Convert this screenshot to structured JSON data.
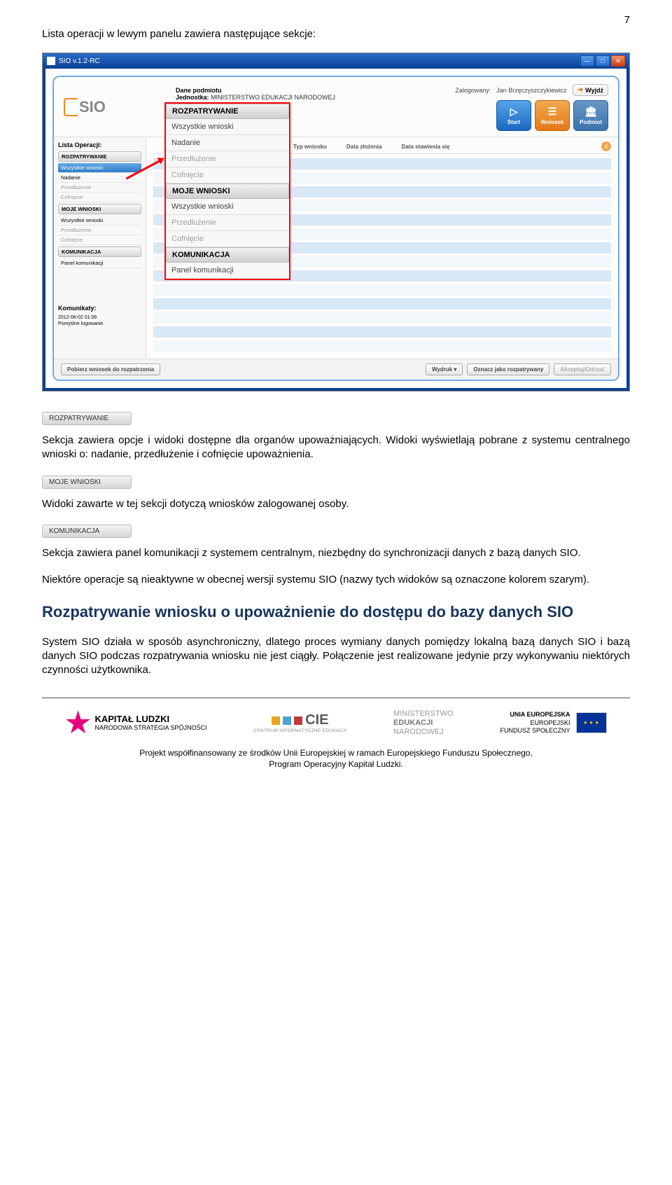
{
  "page_number": "7",
  "intro": "Lista operacji w lewym panelu zawiera następujące sekcje:",
  "screenshot": {
    "titlebar": "SIO v.1.2-RC",
    "logo_text": "SIO",
    "dane_podmiotu_label": "Dane podmiotu",
    "jednostka_label": "Jednostka:",
    "jednostka_value": "MINISTERSTWO EDUKACJI NARODOWEJ",
    "logged_label": "Zalogowany:",
    "logged_value": "Jan Brzęczyszczykiewicz",
    "wyjdz": "Wyjdź",
    "actions": {
      "start": "Start",
      "wniosek": "Wniosek",
      "podmiot": "Podmiot"
    },
    "left_title": "Lista Operacji:",
    "left": {
      "h1": "ROZPATRYWANIE",
      "i1": "Wszystkie wnioski",
      "i2": "Nadanie",
      "i3": "Przedłużenie",
      "i4": "Cofnięcie",
      "h2": "MOJE WNIOSKI",
      "i5": "Wszystkie wnioski",
      "i6": "Przedłużenie",
      "i7": "Cofnięcie",
      "h3": "KOMUNIKACJA",
      "i8": "Panel komunikacji"
    },
    "popup": {
      "h1": "ROZPATRYWANIE",
      "i1": "Wszystkie wnioski",
      "i2": "Nadanie",
      "i3": "Przedłużenie",
      "i4": "Cofnięcie",
      "h2": "MOJE WNIOSKI",
      "i5": "Wszystkie wnioski",
      "i6": "Przedłużenie",
      "i7": "Cofnięcie",
      "h3": "KOMUNIKACJA",
      "i8": "Panel komunikacji"
    },
    "komunikaty_label": "Komunikaty:",
    "komunikat_date": "2012-06-02 01:06",
    "komunikat_text": "Pomyślne logowanie",
    "th": {
      "typ": "Typ wniosku",
      "data_z": "Data złożenia",
      "data_s": "Data stawienia się"
    },
    "footer": {
      "pobierz": "Pobierz wniosek do rozpatrzenia",
      "wydruk": "Wydruk",
      "oznacz": "Oznacz jako rozpatrywany",
      "akceptuj": "Akceptuj/Odrzuć"
    }
  },
  "tab1": "ROZPATRYWANIE",
  "para1": "Sekcja zawiera opcje i widoki dostępne dla organów upoważniających. Widoki wyświetlają pobrane z systemu centralnego wnioski o: nadanie, przedłużenie i cofnięcie upoważnienia.",
  "tab2": "MOJE WNIOSKI",
  "para2": "Widoki zawarte w tej sekcji dotyczą wniosków zalogowanej osoby.",
  "tab3": "KOMUNIKACJA",
  "para3": "Sekcja zawiera panel komunikacji z systemem centralnym, niezbędny do synchronizacji danych z bazą danych SIO.",
  "para4": "Niektóre operacje są nieaktywne w obecnej wersji systemu SIO (nazwy tych widoków są oznaczone kolorem szarym).",
  "heading": "Rozpatrywanie wniosku o upoważnienie do dostępu do bazy danych SIO",
  "para5": "System SIO działa w sposób asynchroniczny, dlatego proces wymiany danych pomiędzy lokalną bazą danych SIO i bazą danych SIO podczas rozpatrywania wniosku nie jest ciągły. Połączenie jest realizowane jedynie przy wykonywaniu niektórych czynności użytkownika.",
  "footer": {
    "kl_big": "KAPITAŁ LUDZKI",
    "kl_small": "NARODOWA STRATEGIA SPÓJNOŚCI",
    "cie": "CIE",
    "cie_sub": "CENTRUM INFORMATYCZNE EDUKACJI",
    "men1": "MINISTERSTWO",
    "men2": "EDUKACJI",
    "men3": "NARODOWEJ",
    "ue1": "UNIA EUROPEJSKA",
    "ue2": "EUROPEJSKI",
    "ue3": "FUNDUSZ SPOŁECZNY",
    "flagstars": "★ ★ ★",
    "line1": "Projekt współfinansowany ze środków Unii Europejskiej w ramach Europejskiego Funduszu Społecznego,",
    "line2": "Program Operacyjny Kapitał Ludzki."
  }
}
